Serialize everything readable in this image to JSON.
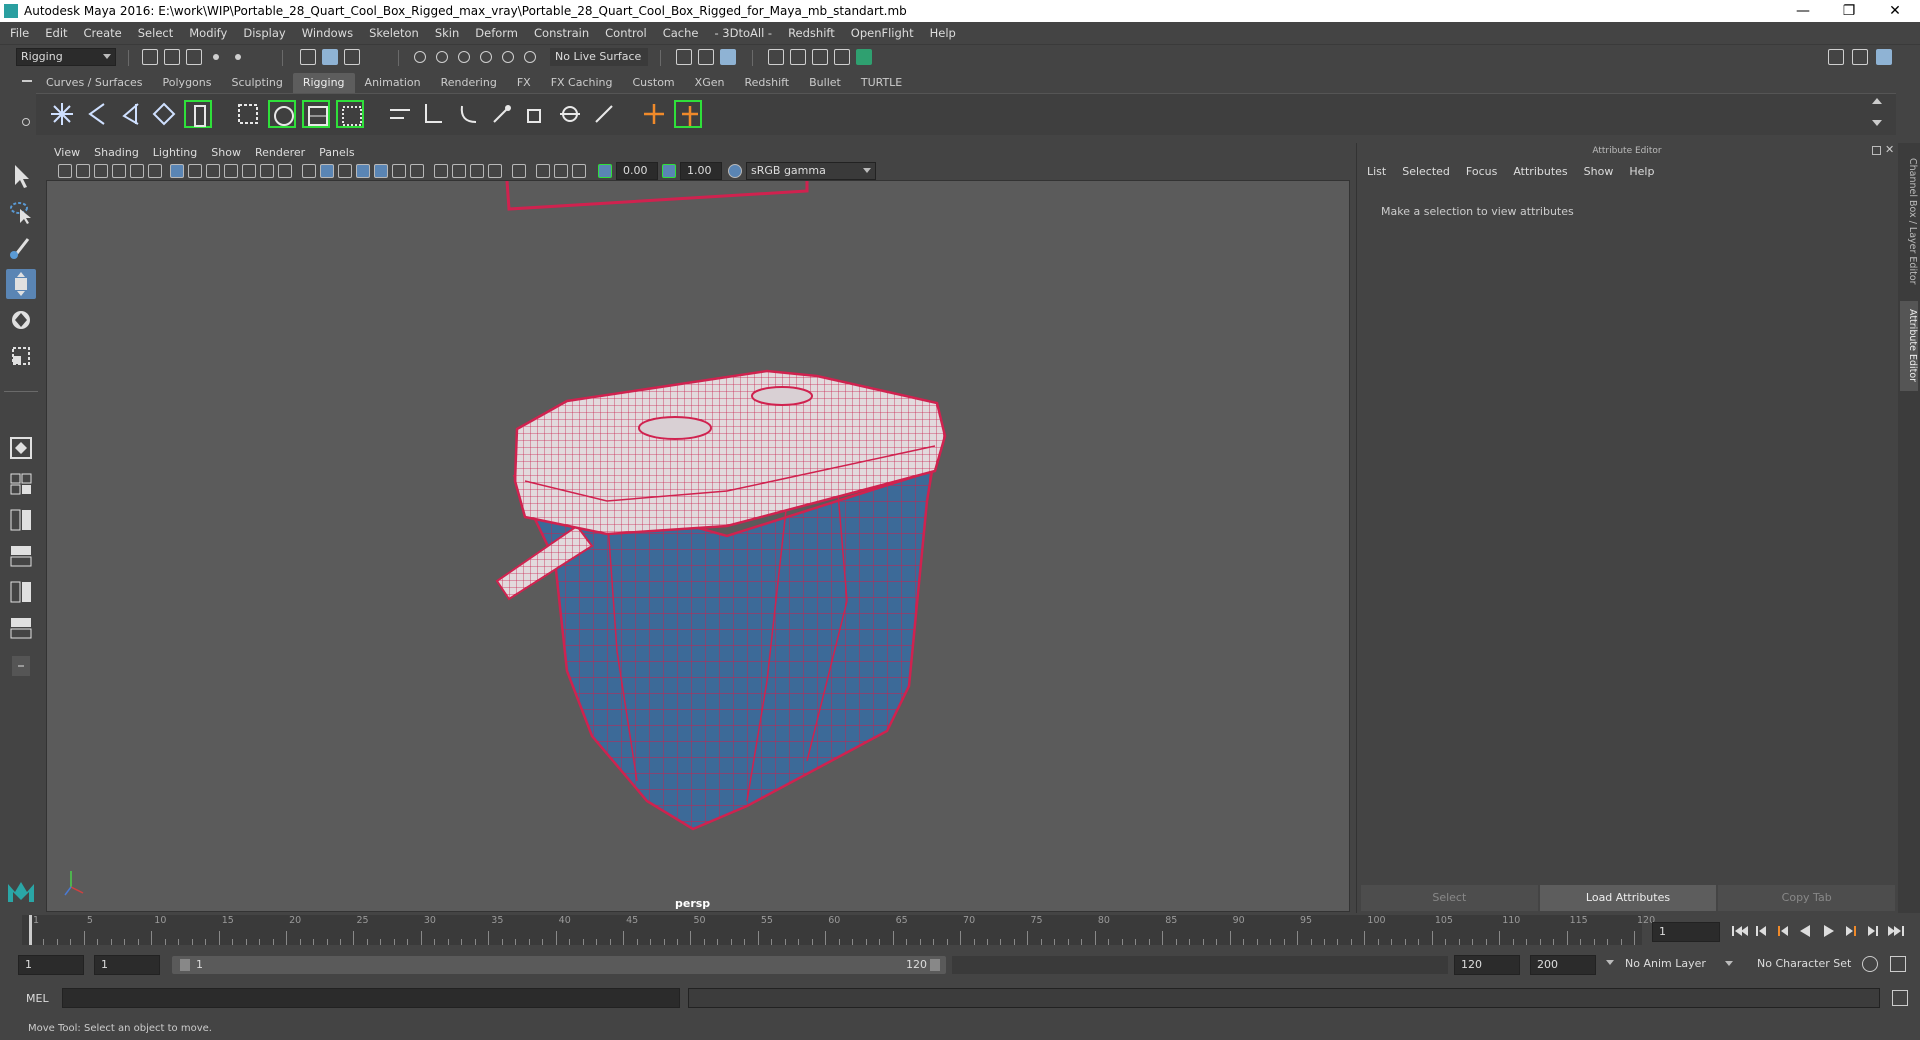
{
  "window": {
    "title": "Autodesk Maya 2016: E:\\work\\WIP\\Portable_28_Quart_Cool_Box_Rigged_max_vray\\Portable_28_Quart_Cool_Box_Rigged_for_Maya_mb_standart.mb",
    "minimize": "—",
    "maximize": "❐",
    "close": "✕"
  },
  "menubar": [
    "File",
    "Edit",
    "Create",
    "Select",
    "Modify",
    "Display",
    "Windows",
    "Skeleton",
    "Skin",
    "Deform",
    "Constrain",
    "Control",
    "Cache",
    "- 3DtoAll -",
    "Redshift",
    "OpenFlight",
    "Help"
  ],
  "statusline": {
    "mode": "Rigging",
    "live_surface": "No Live Surface"
  },
  "shelf_tabs": [
    "Curves / Surfaces",
    "Polygons",
    "Sculpting",
    "Rigging",
    "Animation",
    "Rendering",
    "FX",
    "FX Caching",
    "Custom",
    "XGen",
    "Redshift",
    "Bullet",
    "TURTLE"
  ],
  "active_shelf_tab": "Rigging",
  "viewport": {
    "menu": [
      "View",
      "Shading",
      "Lighting",
      "Show",
      "Renderer",
      "Panels"
    ],
    "exposure": "0.00",
    "gamma": "1.00",
    "color_space": "sRGB gamma",
    "camera": "persp"
  },
  "attribute_editor": {
    "title": "Attribute Editor",
    "menu": [
      "List",
      "Selected",
      "Focus",
      "Attributes",
      "Show",
      "Help"
    ],
    "message": "Make a selection to view attributes",
    "buttons": [
      "Select",
      "Load Attributes",
      "Copy Tab"
    ]
  },
  "side_tabs": [
    "Channel Box / Layer Editor",
    "Attribute Editor"
  ],
  "timeline": {
    "labels": [
      "1",
      "5",
      "10",
      "15",
      "20",
      "25",
      "30",
      "35",
      "40",
      "45",
      "50",
      "55",
      "60",
      "65",
      "70",
      "75",
      "80",
      "85",
      "90",
      "95",
      "100",
      "105",
      "110",
      "115",
      "120"
    ],
    "current_frame": "1"
  },
  "range": {
    "start": "1",
    "playback_start": "1",
    "slider_start": "1",
    "slider_end": "120",
    "playback_end": "120",
    "end": "200",
    "anim_layer": "No Anim Layer",
    "character_set": "No Character Set"
  },
  "cmdline": {
    "label": "MEL"
  },
  "helpline": "Move Tool: Select an object to move.",
  "colors": {
    "accent": "#5a85b4",
    "shelf_highlight": "#2fe03a",
    "wire": "#d0224f",
    "body": "#3f6d9a",
    "lid": "#d9d2d6",
    "viewport_bg": "#5b5b5b"
  }
}
